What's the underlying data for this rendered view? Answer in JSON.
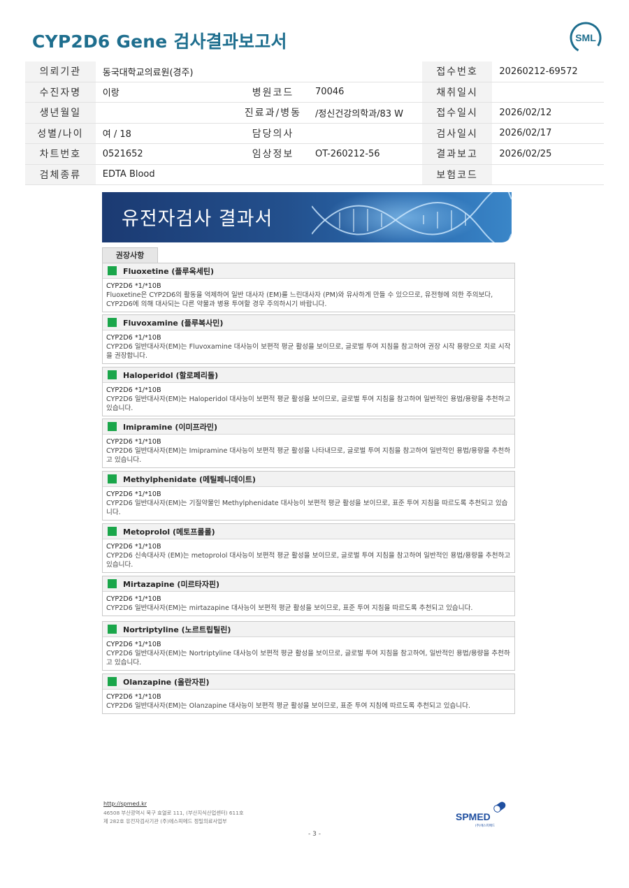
{
  "header": {
    "title": "CYP2D6 Gene 검사결과보고서",
    "logo_text": "SML"
  },
  "info_rows": [
    {
      "l1": "의뢰기관",
      "v1": "동국대학교의료원(경주)",
      "l2": "",
      "v2": "",
      "l3": "접수번호",
      "v3": "20260212-69572"
    },
    {
      "l1": "수진자명",
      "v1": "이랑",
      "l2": "병원코드",
      "v2": "70046",
      "l3": "채취일시",
      "v3": ""
    },
    {
      "l1": "생년월일",
      "v1": "",
      "l2": "진료과/병동",
      "v2": "/정신건강의학과/83 W",
      "l3": "접수일시",
      "v3": "2026/02/12"
    },
    {
      "l1": "성별/나이",
      "v1": "여 / 18",
      "l2": "담당의사",
      "v2": "",
      "l3": "검사일시",
      "v3": "2026/02/17"
    },
    {
      "l1": "차트번호",
      "v1": "0521652",
      "l2": "임상정보",
      "v2": "OT-260212-56",
      "l3": "결과보고",
      "v3": "2026/02/25"
    },
    {
      "l1": "검체종류",
      "v1": "EDTA Blood",
      "l2": "",
      "v2": "",
      "l3": "보험코드",
      "v3": ""
    }
  ],
  "banner": {
    "title": "유전자검사 결과서"
  },
  "recommendations": {
    "tab_label": "권장사항",
    "drugs": [
      {
        "name": "Fluoxetine (플루옥세틴)",
        "genotype": "CYP2D6 *1/*10B",
        "text": "Fluoxetine은 CYP2D6의 활동을 억제하여 일반 대사자 (EM)를 느린대사자 (PM)와 유사하게 만들 수 있으므로, 유전형에 의한 주의보다, CYP2D6에 의해 대사되는 다른 약물과 병용 투여할 경우 주의하시기 바랍니다."
      },
      {
        "name": "Fluvoxamine (플루복사민)",
        "genotype": "CYP2D6 *1/*10B",
        "text": "CYP2D6 일반대사자(EM)는 Fluvoxamine 대사능이 보편적 평균 활성을 보이므로, 글로벌 투여 지침을 참고하여 권장 시작 용량으로 치료 시작을 권장합니다."
      },
      {
        "name": "Haloperidol (할로페리돌)",
        "genotype": "CYP2D6 *1/*10B",
        "text": "CYP2D6 일반대사자(EM)는 Haloperidol 대사능이 보편적 평균 활성을 보이므로, 글로벌 투여 지침을 참고하여 일반적인 용법/용량을 추천하고 있습니다."
      },
      {
        "name": "Imipramine (이미프라민)",
        "genotype": "CYP2D6 *1/*10B",
        "text": "CYP2D6 일반대사자(EM)는 Imipramine 대사능이 보편적 평균 활성을 나타내므로, 글로벌 투여 지침을 참고하여 일반적인 용법/용량을 추천하고 있습니다."
      },
      {
        "name": "Methylphenidate (메틸페니데이트)",
        "genotype": "CYP2D6 *1/*10B",
        "text": "CYP2D6 일반대사자(EM)는 기질약물인 Methylphenidate 대사능이 보편적 평균 활성을 보이므로, 표준 투여 지침을 따르도록 추천되고 있습니다."
      },
      {
        "name": "Metoprolol (메토프롤롤)",
        "genotype": "CYP2D6 *1/*10B",
        "text": "CYP2D6 신속대사자 (EM)는 metoprolol 대사능이 보편적 평균 활성을 보이므로, 글로벌 투여 지침을 참고하여 일반적인 용법/용량을 추천하고 있습니다."
      },
      {
        "name": "Mirtazapine (미르타자핀)",
        "genotype": "CYP2D6 *1/*10B",
        "text": "CYP2D6 일반대사자(EM)는 mirtazapine 대사능이 보편적 평균 활성을 보이므로, 표준 투여 지침을 따르도록 추천되고 있습니다."
      },
      {
        "name": "Nortriptyline (노르트립틸린)",
        "genotype": "CYP2D6 *1/*10B",
        "text": "CYP2D6 일반대사자(EM)는 Nortriptyline 대사능이 보편적 평균 활성을 보이므로, 글로벌 투여 지침을 참고하여, 일반적인 용법/용량을 추천하고 있습니다."
      },
      {
        "name": "Olanzapine (올란자핀)",
        "genotype": "CYP2D6 *1/*10B",
        "text": "CYP2D6 일반대사자(EM)는 Olanzapine 대사능이 보편적 평균 활성을 보이므로, 표준 투여 지침에 따르도록 추천되고 있습니다."
      }
    ]
  },
  "footer": {
    "link": "http://spmed.kr",
    "address": "46508 부산광역시 북구 효열로 111, (부산지식산업센터) 611호",
    "license": "제 282호 유전자검사기관 (주)에스피메드 정밀의료사업부",
    "logo_text": "SPMED",
    "logo_sub": "(주)에스피메드",
    "page": "- 3 -"
  }
}
